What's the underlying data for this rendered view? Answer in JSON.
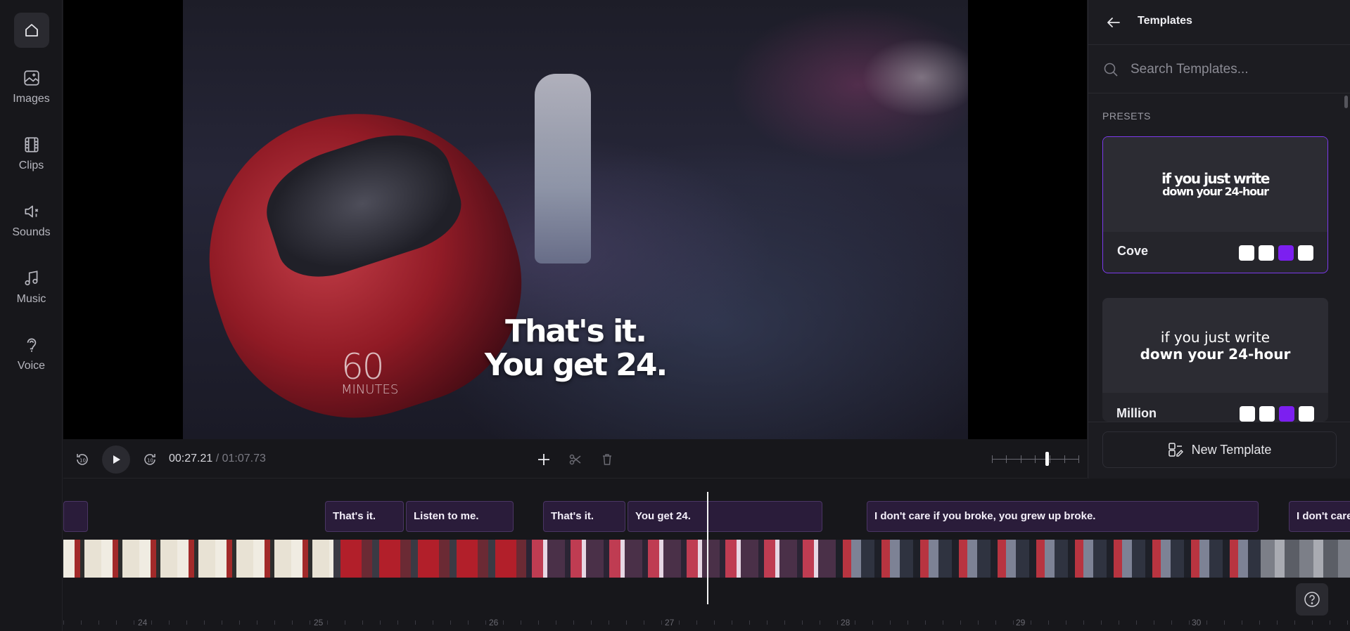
{
  "sidebar": {
    "items": [
      {
        "label": "Images",
        "icon": "image-icon"
      },
      {
        "label": "Clips",
        "icon": "film-icon"
      },
      {
        "label": "Sounds",
        "icon": "sound-icon"
      },
      {
        "label": "Music",
        "icon": "music-icon"
      },
      {
        "label": "Voice",
        "icon": "microphone-icon"
      }
    ]
  },
  "video": {
    "logo_number": "60",
    "logo_word": "MINUTES",
    "caption_line1": "That's it.",
    "caption_line2": "You get 24."
  },
  "player": {
    "current_time": "00:27.21",
    "separator": " / ",
    "total_time": "01:07.73"
  },
  "templates_panel": {
    "title": "Templates",
    "search_placeholder": "Search Templates...",
    "section_label": "PRESETS",
    "presets": [
      {
        "name": "Cove",
        "preview_line1": "if you just write",
        "preview_line2": "down your 24-hour",
        "swatches": [
          "#ffffff",
          "#ffffff",
          "#7c1ff0",
          "#ffffff"
        ],
        "selected": true
      },
      {
        "name": "Million",
        "preview_line1": "if you just write",
        "preview_line2": "down your 24-hour",
        "swatches": [
          "#ffffff",
          "#ffffff",
          "#7c1ff0",
          "#ffffff"
        ],
        "selected": false
      }
    ],
    "new_template_label": "New Template"
  },
  "timeline": {
    "captions": [
      {
        "text": ""
      },
      {
        "text": "That's it."
      },
      {
        "text": "Listen to me."
      },
      {
        "text": "That's it."
      },
      {
        "text": "You get 24."
      },
      {
        "text": "I don't care if you broke, you grew up broke."
      },
      {
        "text": "I don't care"
      }
    ],
    "ruler": [
      "24",
      "25",
      "26",
      "27",
      "28",
      "29",
      "30"
    ]
  },
  "colors": {
    "accent": "#7c3aed",
    "background": "#17171b",
    "panel": "#1c1c21"
  }
}
